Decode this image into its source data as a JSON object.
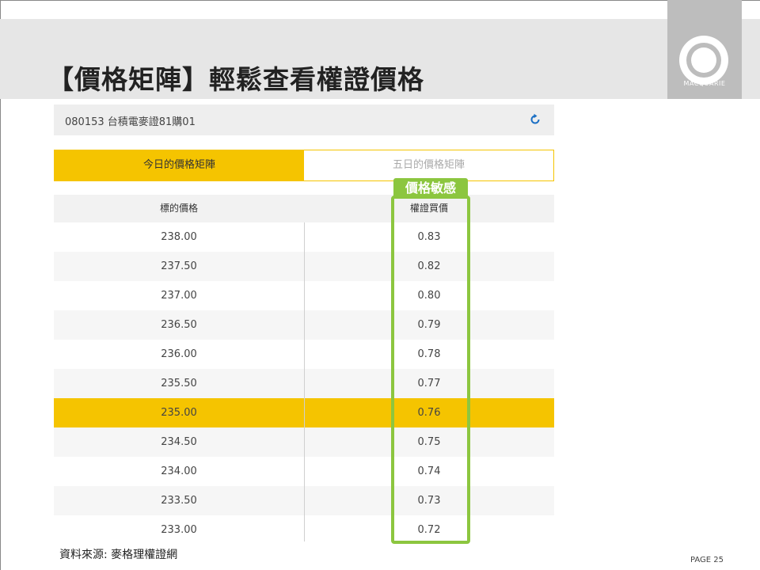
{
  "title": "【價格矩陣】輕鬆查看權證價格",
  "logo": {
    "text": "MACQUARIE"
  },
  "warrant": {
    "name": "080153 台積電麥證81購01",
    "refresh_icon": "refresh-icon"
  },
  "tabs": [
    {
      "label": "今日的價格矩陣",
      "active": true
    },
    {
      "label": "五日的價格矩陣",
      "active": false
    }
  ],
  "table": {
    "headers": {
      "underlying": "標的價格",
      "warrant": "權證買價"
    },
    "rows": [
      {
        "underlying": "238.00",
        "warrant": "0.83"
      },
      {
        "underlying": "237.50",
        "warrant": "0.82"
      },
      {
        "underlying": "237.00",
        "warrant": "0.80"
      },
      {
        "underlying": "236.50",
        "warrant": "0.79"
      },
      {
        "underlying": "236.00",
        "warrant": "0.78"
      },
      {
        "underlying": "235.50",
        "warrant": "0.77"
      },
      {
        "underlying": "235.00",
        "warrant": "0.76",
        "highlight": true
      },
      {
        "underlying": "234.50",
        "warrant": "0.75"
      },
      {
        "underlying": "234.00",
        "warrant": "0.74"
      },
      {
        "underlying": "233.50",
        "warrant": "0.73"
      },
      {
        "underlying": "233.00",
        "warrant": "0.72"
      }
    ]
  },
  "annotation": {
    "label": "價格敏感",
    "color": "#8cc63f"
  },
  "colors": {
    "accent": "#f5c400",
    "header_band": "#e6e6e6",
    "logo_bg": "#bdbdbd"
  },
  "footer": {
    "source": "資料來源: 麥格理權證網",
    "page": "PAGE 25"
  }
}
